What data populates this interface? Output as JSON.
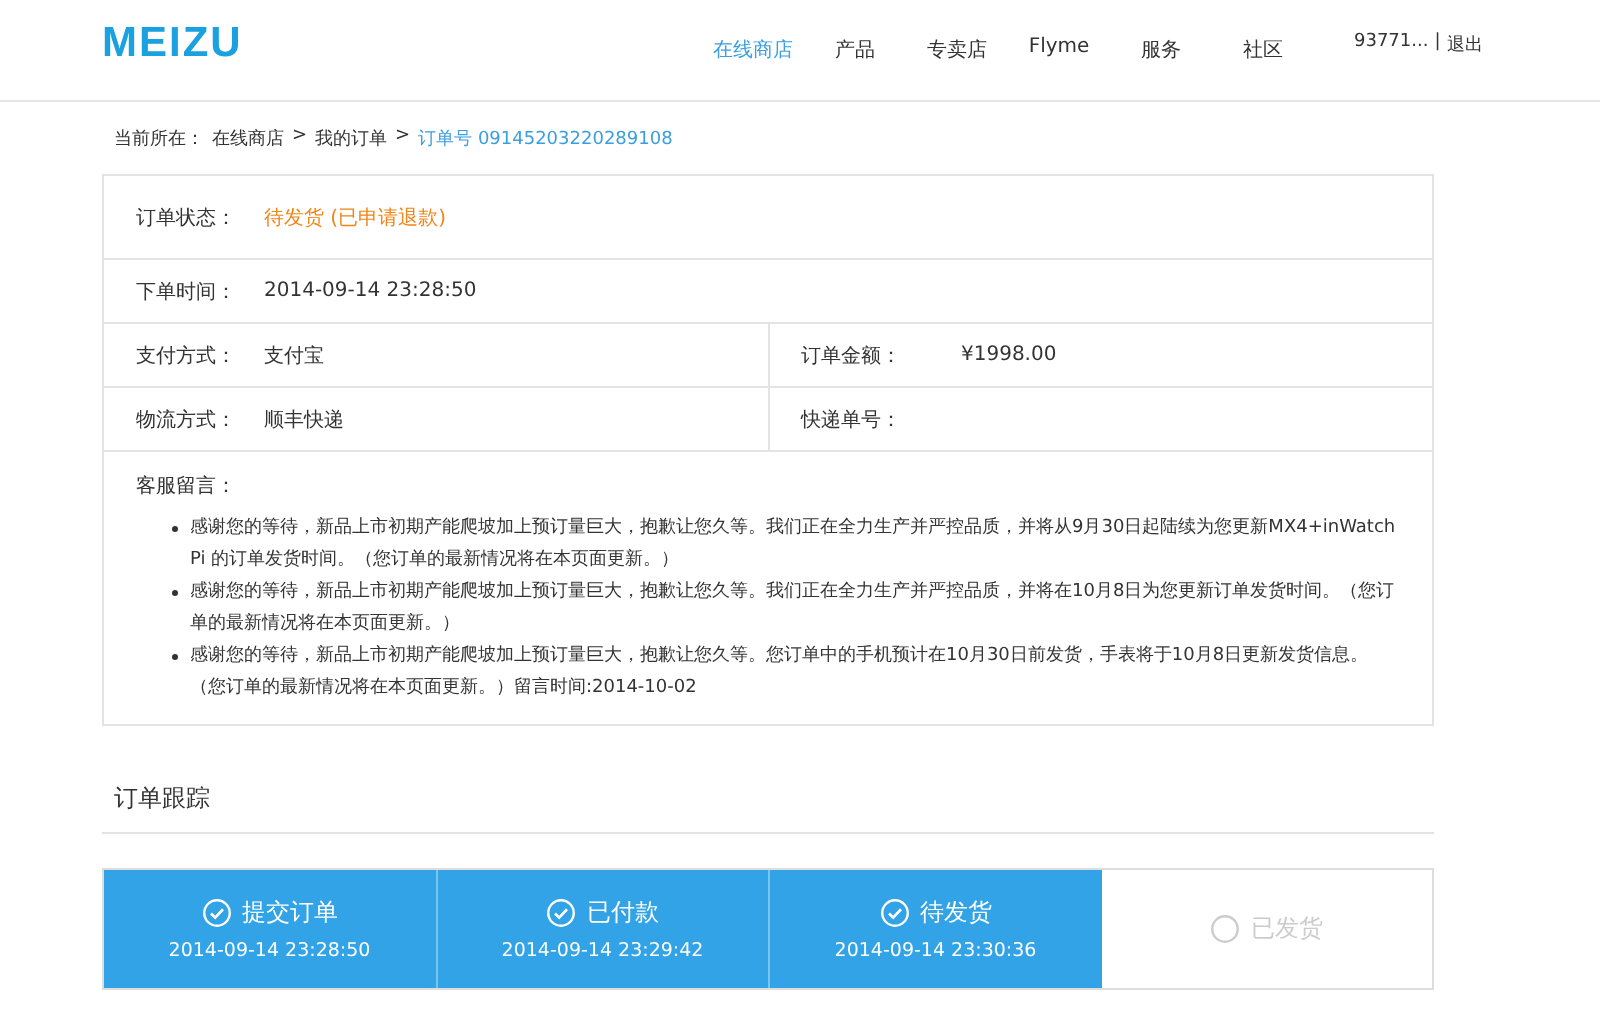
{
  "header": {
    "logo": "MEIZU",
    "nav": [
      {
        "label": "在线商店",
        "selected": true
      },
      {
        "label": "产品",
        "selected": false
      },
      {
        "label": "专卖店",
        "selected": false
      },
      {
        "label": "Flyme",
        "selected": false
      },
      {
        "label": "服务",
        "selected": false
      },
      {
        "label": "社区",
        "selected": false
      }
    ],
    "user": "93771...",
    "separator": "|",
    "logout": "退出"
  },
  "breadcrumb": {
    "prefix": "当前所在：",
    "items": [
      {
        "label": "在线商店",
        "current": false
      },
      {
        "label": "我的订单",
        "current": false
      },
      {
        "label": "订单号 09145203220289108",
        "current": true
      }
    ],
    "separator": ">"
  },
  "order": {
    "status": {
      "label": "订单状态：",
      "value": "待发货 (已申请退款)"
    },
    "time": {
      "label": "下单时间：",
      "value": "2014-09-14 23:28:50"
    },
    "rows": [
      [
        {
          "label": "支付方式：",
          "value": "支付宝"
        },
        {
          "label": "订单金额：",
          "value": "¥1998.00"
        }
      ],
      [
        {
          "label": "物流方式：",
          "value": "顺丰快递"
        },
        {
          "label": "快递单号："
        }
      ]
    ],
    "message": {
      "label": "客服留言：",
      "items": [
        "感谢您的等待，新品上市初期产能爬坡加上预订量巨大，抱歉让您久等。我们正在全力生产并严控品质，并将从9月30日起陆续为您更新MX4+inWatch Pi 的订单发货时间。（您订单的最新情况将在本页面更新。）",
        "感谢您的等待，新品上市初期产能爬坡加上预订量巨大，抱歉让您久等。我们正在全力生产并严控品质，并将在10月8日为您更新订单发货时间。（您订单的最新情况将在本页面更新。）",
        "感谢您的等待，新品上市初期产能爬坡加上预订量巨大，抱歉让您久等。您订单中的手机预计在10月30日前发货，手表将于10月8日更新发货信息。（您订单的最新情况将在本页面更新。）留言时间:2014-10-02"
      ]
    }
  },
  "tracking": {
    "title": "订单跟踪",
    "steps": [
      {
        "label": "提交订单",
        "time": "2014-09-14 23:28:50",
        "done": true
      },
      {
        "label": "已付款",
        "time": "2014-09-14 23:29:42",
        "done": true
      },
      {
        "label": "待发货",
        "time": "2014-09-14 23:30:36",
        "done": true
      },
      {
        "label": "已发货",
        "done": false
      }
    ]
  }
}
